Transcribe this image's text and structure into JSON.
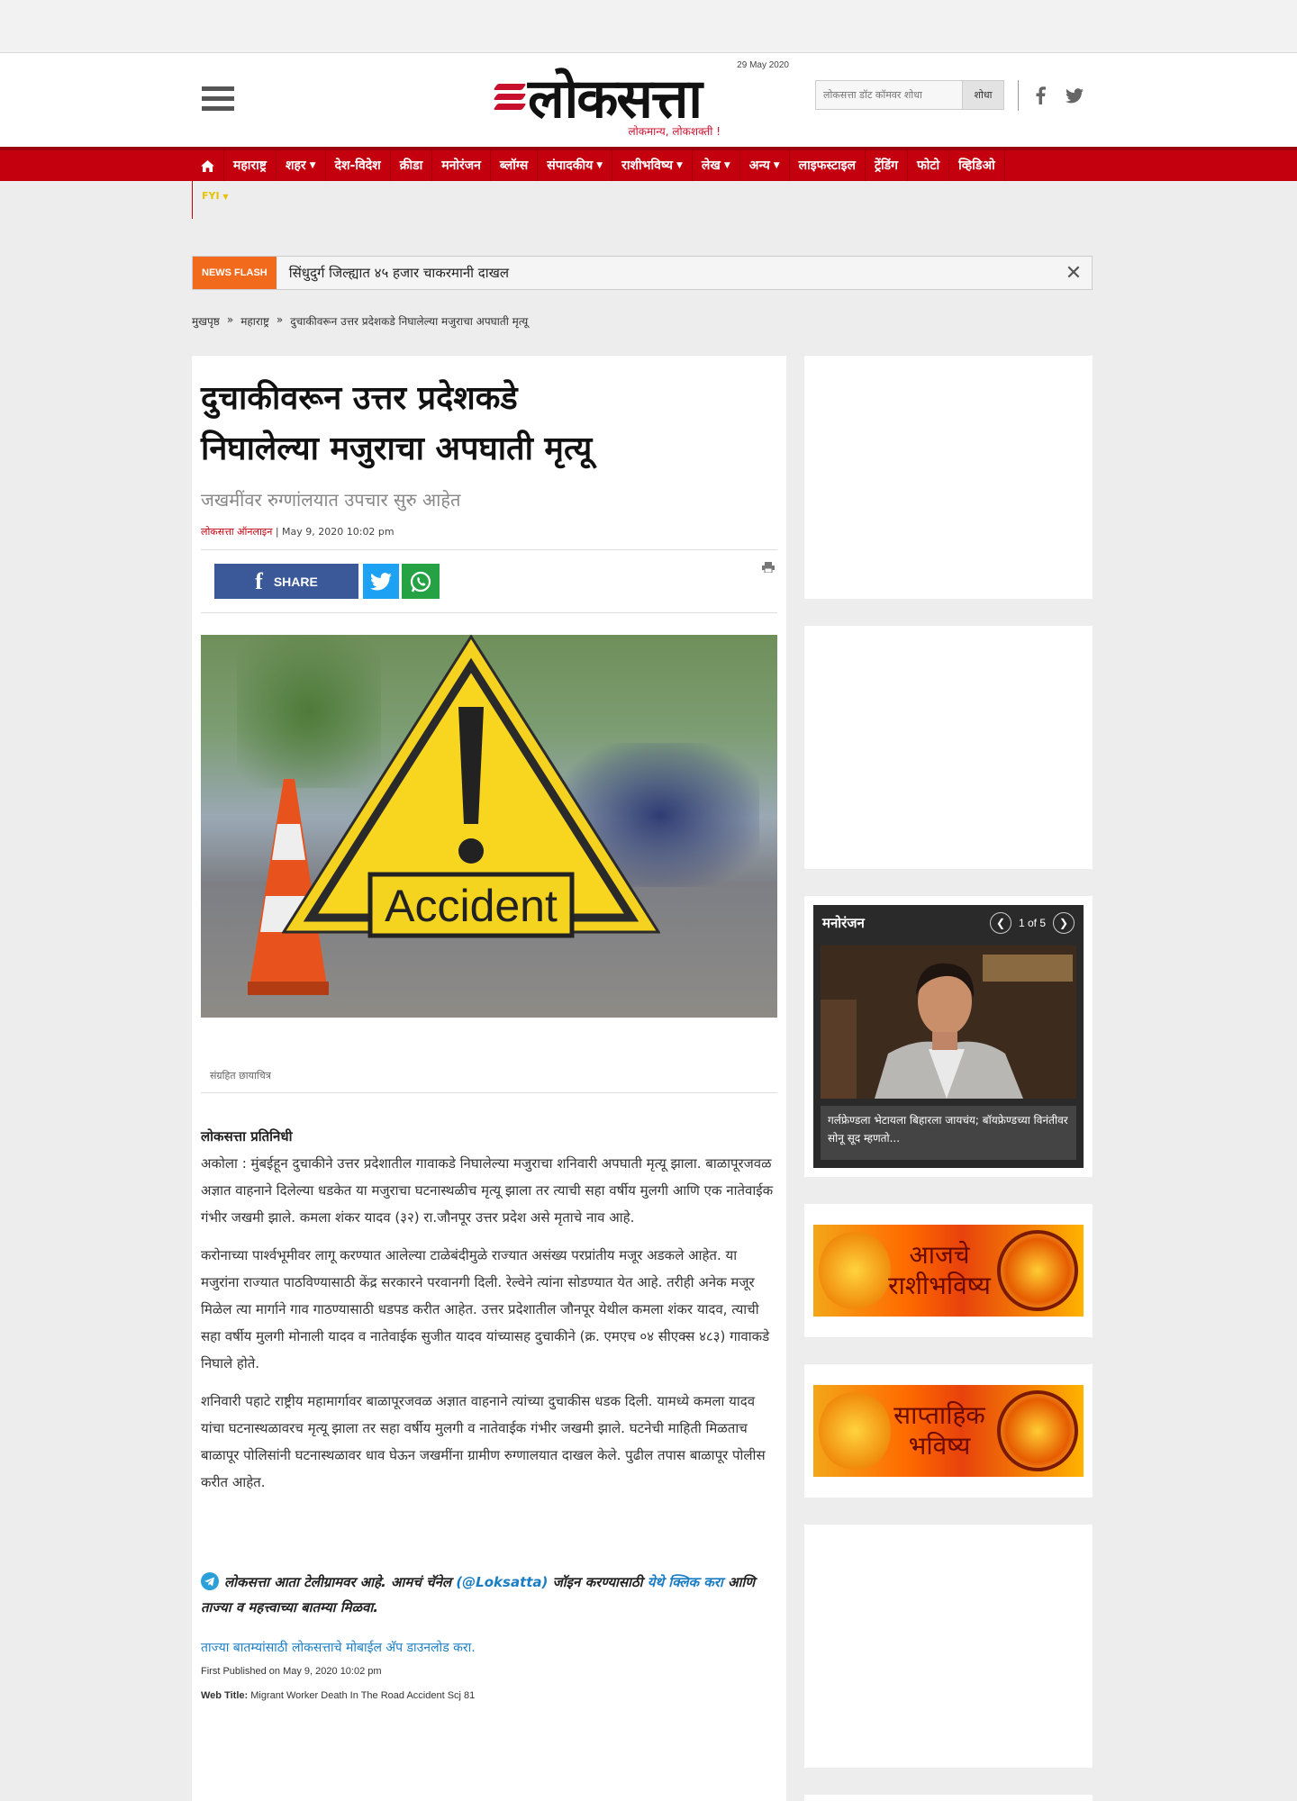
{
  "header": {
    "date": "29 May 2020",
    "logo_text": "लोकसत्ता",
    "tagline": "लोकमान्य, लोकशक्ती !",
    "search_placeholder": "लोकसत्ता डॉट कॉमवर शोधा",
    "search_button": "शोधा"
  },
  "nav": {
    "items": [
      {
        "label": "महाराष्ट्र",
        "caret": false
      },
      {
        "label": "शहर",
        "caret": true
      },
      {
        "label": "देश-विदेश",
        "caret": false
      },
      {
        "label": "क्रीडा",
        "caret": false
      },
      {
        "label": "मनोरंजन",
        "caret": false
      },
      {
        "label": "ब्लॉग्स",
        "caret": false
      },
      {
        "label": "संपादकीय",
        "caret": true
      },
      {
        "label": "राशीभविष्य",
        "caret": true
      },
      {
        "label": "लेख",
        "caret": true
      },
      {
        "label": "अन्य",
        "caret": true
      },
      {
        "label": "लाइफस्टाइल",
        "caret": false
      },
      {
        "label": "ट्रेंडिंग",
        "caret": false
      },
      {
        "label": "फोटो",
        "caret": false
      },
      {
        "label": "व्हिडिओ",
        "caret": false
      }
    ],
    "fyi": "FYI"
  },
  "newsflash": {
    "tag": "NEWS FLASH",
    "text": "सिंधुदुर्ग जिल्ह्यात ४५ हजार चाकरमानी दाखल"
  },
  "breadcrumb": {
    "home": "मुखपृष्ठ",
    "sep1": "»",
    "section": "महाराष्ट्र",
    "sep2": "»",
    "current": "दुचाकीवरून उत्तर प्रदेशकडे निघालेल्या मजुराचा अपघाती मृत्यू"
  },
  "article": {
    "title_line1": "दुचाकीवरून उत्तर प्रदेशकडे",
    "title_line2": "निघालेल्या मजुराचा अपघाती मृत्यू",
    "subtitle": "जखमींवर रुग्णांलयात उपचार सुरु आहेत",
    "author": "लोकसत्ता ऑनलाइन",
    "date": "| May 9, 2020 10:02 pm",
    "share_label": "SHARE",
    "image_sign_text": "Accident",
    "caption": "संग्रहित छायाचित्र",
    "reporter": "लोकसत्ता प्रतिनिधी",
    "paragraphs": [
      "अकोला : मुंबईहून दुचाकीने उत्तर प्रदेशातील गावाकडे निघालेल्या मजुराचा शनिवारी अपघाती मृत्यू झाला. बाळापूरजवळ अज्ञात वाहनाने दिलेल्या धडकेत या मजुराचा घटनास्थळीच मृत्यू झाला तर त्याची सहा वर्षीय मुलगी आणि एक नातेवाईक गंभीर जखमी झाले. कमला शंकर यादव (३२) रा.जौनपूर उत्तर प्रदेश असे मृताचे नाव आहे.",
      "करोनाच्या पार्श्वभूमीवर लागू करण्यात आलेल्या टाळेबंदीमुळे राज्यात असंख्य परप्रांतीय मजूर अडकले आहेत. या मजुरांना राज्यात पाठविण्यासाठी केंद्र सरकारने परवानगी दिली. रेल्वेने त्यांना सोडण्यात येत आहे. तरीही अनेक मजूर मिळेल त्या मार्गाने गाव गाठण्यासाठी धडपड करीत आहेत. उत्तर प्रदेशातील जौनपूर येथील कमला शंकर यादव, त्याची सहा वर्षीय मुलगी मोनाली यादव व नातेवाईक सुजीत यादव यांच्यासह दुचाकीने (क्र. एमएच ०४ सीएक्स ४८३) गावाकडे निघाले होते.",
      "शनिवारी पहाटे राष्ट्रीय महामार्गावर बाळापूरजवळ अज्ञात वाहनाने त्यांच्या दुचाकीस धडक दिली. यामध्ये कमला यादव यांचा घटनास्थळावरच मृत्यू झाला तर सहा वर्षीय मुलगी व नातेवाईक गंभीर जखमी झाले. घटनेची माहिती मिळताच बाळापूर पोलिसांनी घटनास्थळावर धाव घेऊन जखमींना ग्रामीण रुग्णालयात दाखल केले. पुढील तपास बाळापूर पोलीस करीत आहेत."
    ],
    "telegram_text1": "लोकसत्ता आता टेलीग्रामवर आहे. आमचं चॅनेल",
    "telegram_handle": "(@Loksatta)",
    "telegram_text2": "जॉइन करण्यासाठी",
    "telegram_link": "येथे क्लिक करा",
    "telegram_text3": "आणि ताज्या व महत्त्वाच्या बातम्या मिळवा.",
    "app_link": "ताज्या बातम्यांसाठी लोकसत्ताचे मोबाईल अ‍ॅप डाउनलोड करा.",
    "first_published": "First Published on May 9, 2020 10:02 pm",
    "web_title_label": "Web Title:",
    "web_title": "Migrant Worker Death In The Road Accident Scj 81"
  },
  "sidebar": {
    "entertainment": {
      "heading": "मनोरंजन",
      "pager": "1 of 5",
      "caption": "गर्लफ्रेण्डला भेटायला बिहारला जायचंय; बॉयफ्रेण्डच्या विनंतीवर सोनू सूद म्हणतो..."
    },
    "rashi_daily": "आजचे राशीभविष्य",
    "rashi_weekly": "साप्ताहिक भविष्य"
  },
  "colors": {
    "brand_red": "#c4000f",
    "newsflash_orange": "#f26b1d",
    "facebook": "#3b5998",
    "twitter": "#1da1f2",
    "whatsapp": "#25a244",
    "link_blue": "#1a7dc4"
  }
}
